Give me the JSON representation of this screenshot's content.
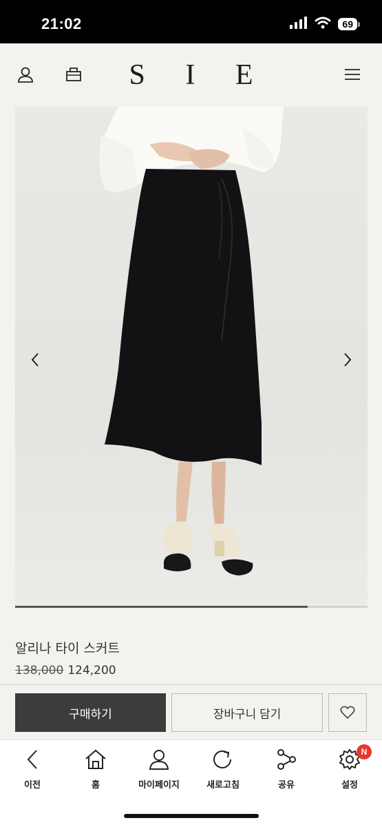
{
  "status_bar": {
    "time": "21:02",
    "battery": "69"
  },
  "header": {
    "logo": "S I E",
    "icons": [
      "user-icon",
      "bag-icon",
      "menu-icon"
    ]
  },
  "gallery": {
    "current_slide": 1,
    "progress_fraction": 0.83
  },
  "product": {
    "name": "알리나 타이 스커트",
    "original_price": "138,000",
    "sale_price": "124,200"
  },
  "actions": {
    "buy_label": "구매하기",
    "cart_label": "장바구니 담기",
    "wishlist_icon": "heart-icon"
  },
  "bottom_nav": {
    "items": [
      {
        "label": "이전",
        "icon": "back-icon"
      },
      {
        "label": "홈",
        "icon": "home-icon"
      },
      {
        "label": "마이페이지",
        "icon": "person-icon"
      },
      {
        "label": "새로고침",
        "icon": "refresh-icon"
      },
      {
        "label": "공유",
        "icon": "share-icon"
      },
      {
        "label": "설정",
        "icon": "settings-icon",
        "badge": "N"
      }
    ]
  },
  "colors": {
    "background": "#f3f2ee",
    "buy_button": "#3c3c3c",
    "badge": "#e8372b"
  }
}
